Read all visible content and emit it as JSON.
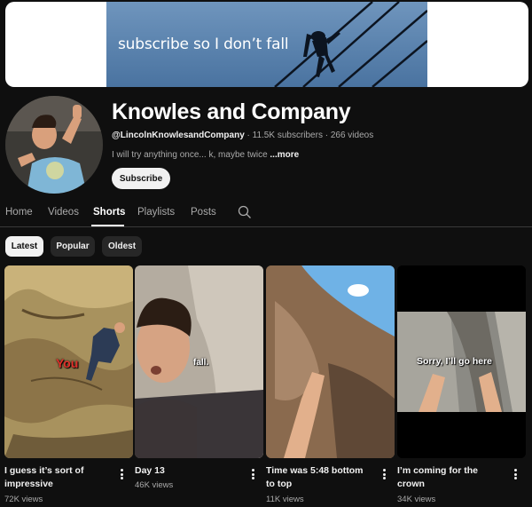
{
  "banner": {
    "text": "subscribe so I don’t  fall"
  },
  "channel": {
    "name": "Knowles and Company",
    "handle": "@LincolnKnowlesandCompany",
    "meta_rest": " · 11.5K subscribers · 266 videos",
    "description": "I will try anything once... k, maybe twice ",
    "more_label": "...more",
    "subscribe_label": "Subscribe"
  },
  "tabs": [
    {
      "label": "Home"
    },
    {
      "label": "Videos"
    },
    {
      "label": "Shorts",
      "active": true
    },
    {
      "label": "Playlists"
    },
    {
      "label": "Posts"
    }
  ],
  "search_icon": "search-icon",
  "filters": [
    {
      "label": "Latest",
      "active": true
    },
    {
      "label": "Popular"
    },
    {
      "label": "Oldest"
    }
  ],
  "shorts": [
    {
      "title": "I guess it’s sort of impressive",
      "views": "72K views",
      "overlay": "You"
    },
    {
      "title": "Day 13  ",
      "views": "46K views",
      "overlay": "fall."
    },
    {
      "title": "Time was 5:48 bottom to top",
      "views": "11K views",
      "overlay": ""
    },
    {
      "title": "I’m coming for the crown",
      "views": "34K views",
      "overlay": "Sorry, I’ll go here"
    }
  ],
  "colors": {
    "background": "#0f0f0f",
    "text_primary": "#f1f1f1",
    "text_secondary": "#aaaaaa",
    "chip": "#272727",
    "overlay_red": "#e0302a"
  }
}
